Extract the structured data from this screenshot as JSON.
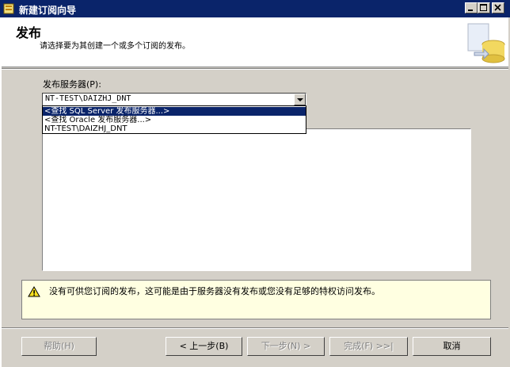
{
  "window": {
    "title": "新建订阅向导"
  },
  "header": {
    "title": "发布",
    "description": "请选择要为其创建一个或多个订阅的发布。"
  },
  "publisher": {
    "label": "发布服务器(P):",
    "selected": "NT-TEST\\DAIZHJ_DNT",
    "options": [
      "<查找 SQL Server 发布服务器...>",
      "<查找 Oracle 发布服务器...>",
      "NT-TEST\\DAIZHJ_DNT"
    ]
  },
  "info": {
    "message": "没有可供您订阅的发布，这可能是由于服务器没有发布或您没有足够的特权访问发布。"
  },
  "buttons": {
    "help": "帮助(H)",
    "back": "< 上一步(B)",
    "next": "下一步(N) >",
    "finish": "完成(F) >>|",
    "cancel": "取消"
  }
}
